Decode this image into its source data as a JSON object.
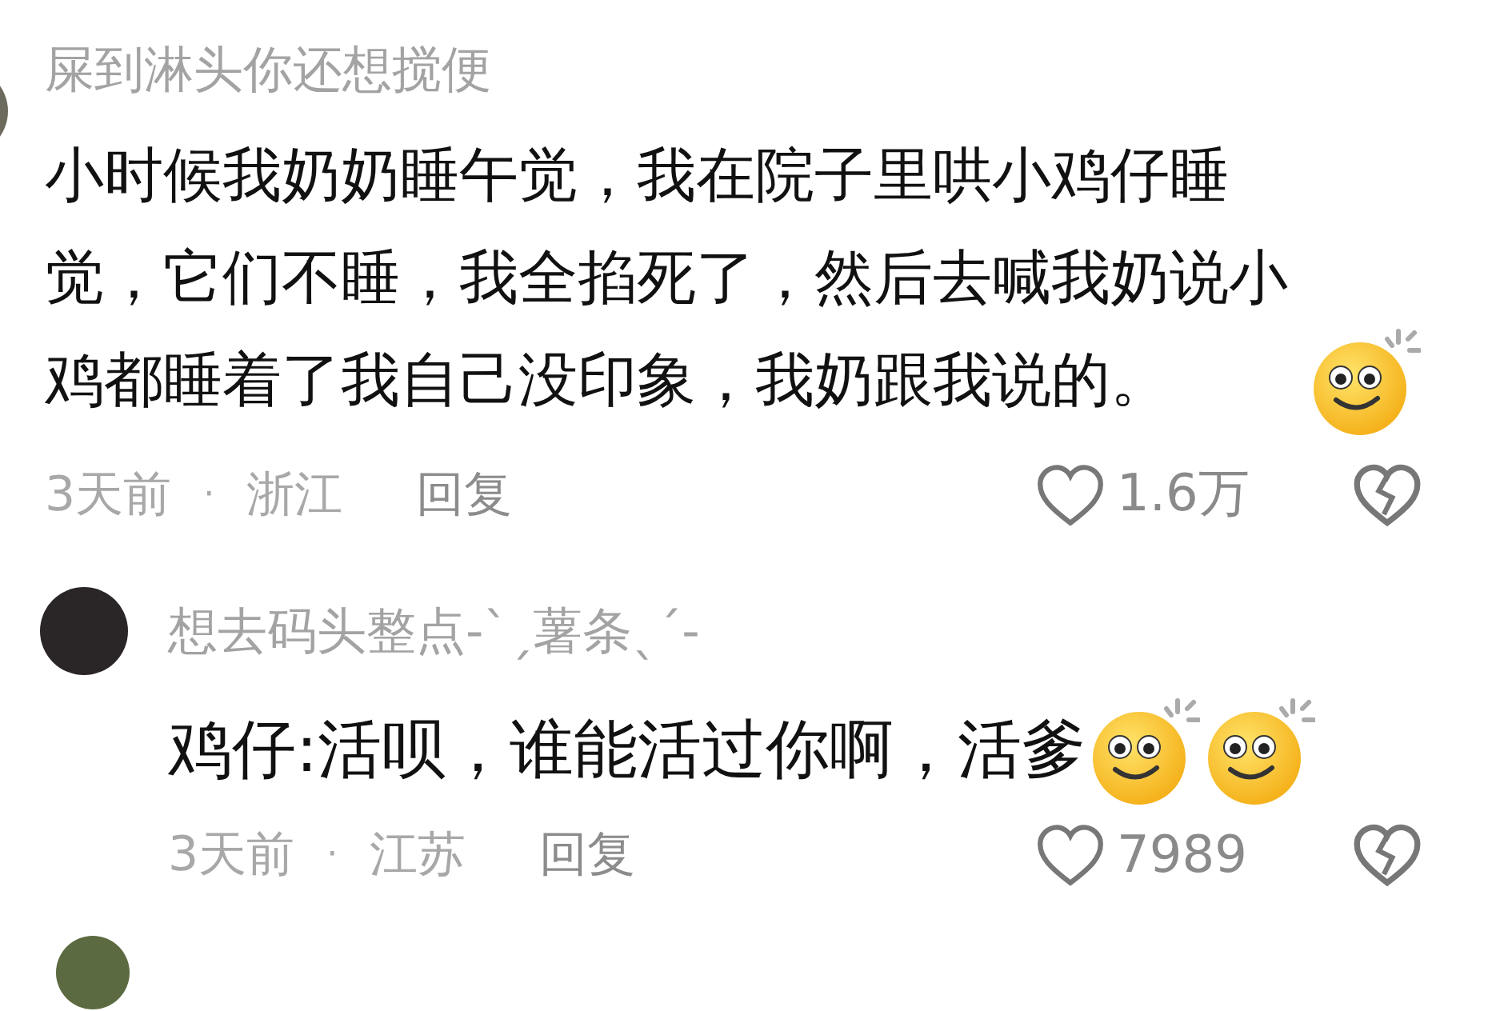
{
  "comments": [
    {
      "kind": "full",
      "username": "屎到淋头你还想搅便",
      "text": "小时候我奶奶睡午觉，我在院子里哄小鸡仔睡觉，它们不睡，我全掐死了，然后去喊我奶说小鸡都睡着了我自己没印象，我奶跟我说的。",
      "emojis": [
        {
          "kind": "smile"
        }
      ],
      "time": "3天前",
      "separator": "·",
      "location": "浙江",
      "reply": "回复",
      "likes": "1.6万",
      "replies": [
        {
          "kind": "full",
          "username": "想去码头整点-ˋˏ薯条ˎˊ-",
          "text": "鸡仔:活呗，谁能活过你啊，活爹",
          "emojis": [
            {
              "kind": "smile"
            },
            {
              "kind": "smile"
            }
          ],
          "time": "3天前",
          "separator": "·",
          "location": "江苏",
          "reply": "回复",
          "likes": "7989"
        }
      ]
    },
    {
      "kind": "cut"
    }
  ]
}
